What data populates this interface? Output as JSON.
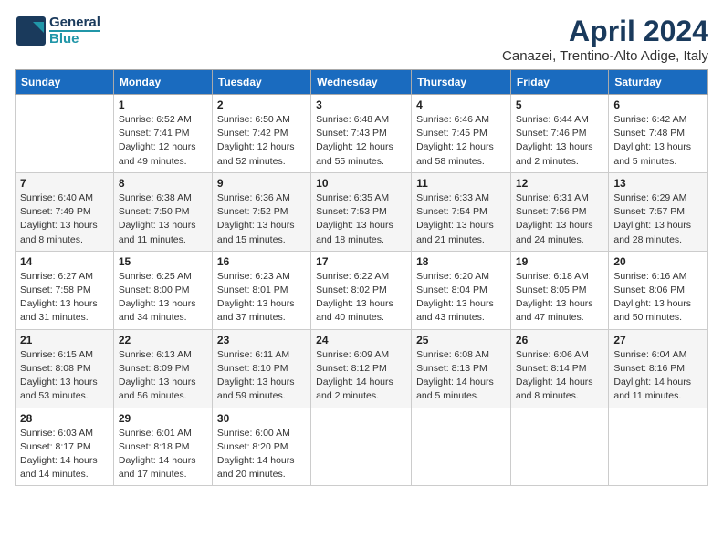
{
  "logo": {
    "line1": "General",
    "line2": "Blue"
  },
  "title": "April 2024",
  "subtitle": "Canazei, Trentino-Alto Adige, Italy",
  "weekdays": [
    "Sunday",
    "Monday",
    "Tuesday",
    "Wednesday",
    "Thursday",
    "Friday",
    "Saturday"
  ],
  "weeks": [
    [
      {
        "day": "",
        "detail": ""
      },
      {
        "day": "1",
        "detail": "Sunrise: 6:52 AM\nSunset: 7:41 PM\nDaylight: 12 hours\nand 49 minutes."
      },
      {
        "day": "2",
        "detail": "Sunrise: 6:50 AM\nSunset: 7:42 PM\nDaylight: 12 hours\nand 52 minutes."
      },
      {
        "day": "3",
        "detail": "Sunrise: 6:48 AM\nSunset: 7:43 PM\nDaylight: 12 hours\nand 55 minutes."
      },
      {
        "day": "4",
        "detail": "Sunrise: 6:46 AM\nSunset: 7:45 PM\nDaylight: 12 hours\nand 58 minutes."
      },
      {
        "day": "5",
        "detail": "Sunrise: 6:44 AM\nSunset: 7:46 PM\nDaylight: 13 hours\nand 2 minutes."
      },
      {
        "day": "6",
        "detail": "Sunrise: 6:42 AM\nSunset: 7:48 PM\nDaylight: 13 hours\nand 5 minutes."
      }
    ],
    [
      {
        "day": "7",
        "detail": "Sunrise: 6:40 AM\nSunset: 7:49 PM\nDaylight: 13 hours\nand 8 minutes."
      },
      {
        "day": "8",
        "detail": "Sunrise: 6:38 AM\nSunset: 7:50 PM\nDaylight: 13 hours\nand 11 minutes."
      },
      {
        "day": "9",
        "detail": "Sunrise: 6:36 AM\nSunset: 7:52 PM\nDaylight: 13 hours\nand 15 minutes."
      },
      {
        "day": "10",
        "detail": "Sunrise: 6:35 AM\nSunset: 7:53 PM\nDaylight: 13 hours\nand 18 minutes."
      },
      {
        "day": "11",
        "detail": "Sunrise: 6:33 AM\nSunset: 7:54 PM\nDaylight: 13 hours\nand 21 minutes."
      },
      {
        "day": "12",
        "detail": "Sunrise: 6:31 AM\nSunset: 7:56 PM\nDaylight: 13 hours\nand 24 minutes."
      },
      {
        "day": "13",
        "detail": "Sunrise: 6:29 AM\nSunset: 7:57 PM\nDaylight: 13 hours\nand 28 minutes."
      }
    ],
    [
      {
        "day": "14",
        "detail": "Sunrise: 6:27 AM\nSunset: 7:58 PM\nDaylight: 13 hours\nand 31 minutes."
      },
      {
        "day": "15",
        "detail": "Sunrise: 6:25 AM\nSunset: 8:00 PM\nDaylight: 13 hours\nand 34 minutes."
      },
      {
        "day": "16",
        "detail": "Sunrise: 6:23 AM\nSunset: 8:01 PM\nDaylight: 13 hours\nand 37 minutes."
      },
      {
        "day": "17",
        "detail": "Sunrise: 6:22 AM\nSunset: 8:02 PM\nDaylight: 13 hours\nand 40 minutes."
      },
      {
        "day": "18",
        "detail": "Sunrise: 6:20 AM\nSunset: 8:04 PM\nDaylight: 13 hours\nand 43 minutes."
      },
      {
        "day": "19",
        "detail": "Sunrise: 6:18 AM\nSunset: 8:05 PM\nDaylight: 13 hours\nand 47 minutes."
      },
      {
        "day": "20",
        "detail": "Sunrise: 6:16 AM\nSunset: 8:06 PM\nDaylight: 13 hours\nand 50 minutes."
      }
    ],
    [
      {
        "day": "21",
        "detail": "Sunrise: 6:15 AM\nSunset: 8:08 PM\nDaylight: 13 hours\nand 53 minutes."
      },
      {
        "day": "22",
        "detail": "Sunrise: 6:13 AM\nSunset: 8:09 PM\nDaylight: 13 hours\nand 56 minutes."
      },
      {
        "day": "23",
        "detail": "Sunrise: 6:11 AM\nSunset: 8:10 PM\nDaylight: 13 hours\nand 59 minutes."
      },
      {
        "day": "24",
        "detail": "Sunrise: 6:09 AM\nSunset: 8:12 PM\nDaylight: 14 hours\nand 2 minutes."
      },
      {
        "day": "25",
        "detail": "Sunrise: 6:08 AM\nSunset: 8:13 PM\nDaylight: 14 hours\nand 5 minutes."
      },
      {
        "day": "26",
        "detail": "Sunrise: 6:06 AM\nSunset: 8:14 PM\nDaylight: 14 hours\nand 8 minutes."
      },
      {
        "day": "27",
        "detail": "Sunrise: 6:04 AM\nSunset: 8:16 PM\nDaylight: 14 hours\nand 11 minutes."
      }
    ],
    [
      {
        "day": "28",
        "detail": "Sunrise: 6:03 AM\nSunset: 8:17 PM\nDaylight: 14 hours\nand 14 minutes."
      },
      {
        "day": "29",
        "detail": "Sunrise: 6:01 AM\nSunset: 8:18 PM\nDaylight: 14 hours\nand 17 minutes."
      },
      {
        "day": "30",
        "detail": "Sunrise: 6:00 AM\nSunset: 8:20 PM\nDaylight: 14 hours\nand 20 minutes."
      },
      {
        "day": "",
        "detail": ""
      },
      {
        "day": "",
        "detail": ""
      },
      {
        "day": "",
        "detail": ""
      },
      {
        "day": "",
        "detail": ""
      }
    ]
  ]
}
